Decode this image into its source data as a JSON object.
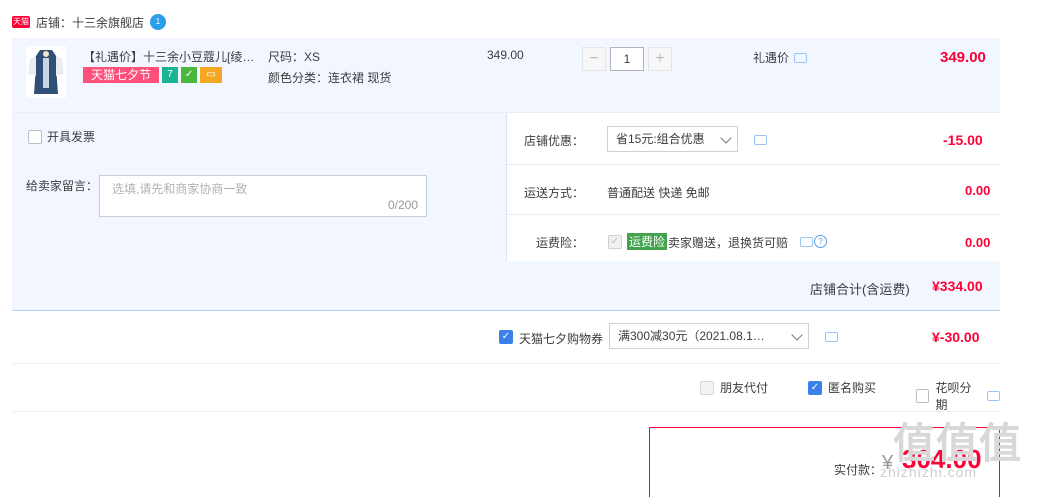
{
  "shop": {
    "logo_text": "天猫",
    "name": "店铺：十三余旗舰店",
    "ww_badge": "1"
  },
  "item": {
    "title": "【礼遇价】十三余小豆蔻儿[绫…",
    "festival_tag": "天猫七夕节",
    "badge_seven": "7",
    "sku_size": "尺码：XS",
    "sku_color": "颜色分类：连衣裙 现货",
    "unit_price": "349.00",
    "qty_minus": "−",
    "qty_value": "1",
    "qty_plus": "+",
    "gift_price_label": "礼遇价",
    "total": "349.00"
  },
  "order": {
    "invoice_label": "开具发票",
    "message_label": "给卖家留言：",
    "message_placeholder": "选填,请先和商家协商一致",
    "message_count": "0/200",
    "shop_discount_label": "店铺优惠：",
    "shop_discount_value": "省15元:组合优惠",
    "shop_discount_amount": "-15.00",
    "shipping_label": "运送方式：",
    "shipping_value": "普通配送 快递 免邮",
    "shipping_amount": "0.00",
    "freight_ins_label": "运费险：",
    "freight_ins_tag": "运费险",
    "freight_ins_desc": "卖家赠送，退换货可赔",
    "freight_ins_amount": "0.00",
    "subtotal_label": "店铺合计(含运费)",
    "subtotal_value": "¥334.00"
  },
  "coupon": {
    "label": "天猫七夕购物券",
    "value": "满300减30元（2021.08.1…",
    "amount": "¥-30.00"
  },
  "options": {
    "friend_pay": "朋友代付",
    "anonymous": "匿名购买",
    "huabei": "花呗分期"
  },
  "payment": {
    "label": "实付款：",
    "symbol": "¥",
    "value": "304.00"
  },
  "watermark": {
    "main": "值值值",
    "sub": "zhizhizhi.com"
  },
  "colors": {
    "accent": "#ff0036",
    "panel_bg": "#f2f7ff",
    "checkbox_on": "#3c7fe8"
  }
}
